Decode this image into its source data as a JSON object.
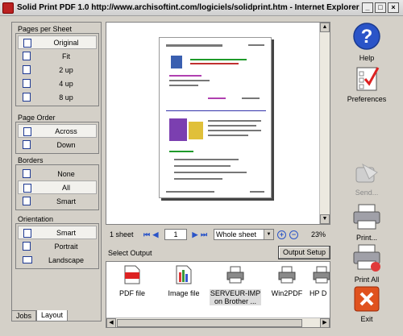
{
  "window": {
    "title": "Solid Print PDF 1.0 http://www.archisoftint.com/logiciels/solidprint.htm - Internet Explorer"
  },
  "left": {
    "pages_per_sheet": {
      "title": "Pages per Sheet",
      "items": [
        "Original",
        "Fit",
        "2 up",
        "4 up",
        "8 up"
      ],
      "selected": "Original"
    },
    "page_order": {
      "title": "Page Order",
      "items": [
        "Across",
        "Down"
      ],
      "selected": "Across"
    },
    "borders": {
      "title": "Borders",
      "items": [
        "None",
        "All",
        "Smart"
      ],
      "selected": "All"
    },
    "orientation": {
      "title": "Orientation",
      "items": [
        "Smart",
        "Portrait",
        "Landscape"
      ],
      "selected": "Smart"
    },
    "tabs": [
      "Jobs",
      "Layout"
    ],
    "active_tab": "Layout"
  },
  "navbar": {
    "sheets": "1 sheet",
    "page": "1",
    "range": "Whole sheet",
    "zoom": "23%"
  },
  "output": {
    "label": "Select Output",
    "setup_button": "Output Setup",
    "items": [
      {
        "label": "PDF file",
        "icon": "pdf-file-icon"
      },
      {
        "label": "Image file",
        "icon": "image-file-icon"
      },
      {
        "label": "SERVEUR-IMP on Brother ...",
        "icon": "printer-icon"
      },
      {
        "label": "Win2PDF",
        "icon": "printer-icon"
      },
      {
        "label": "HP D",
        "icon": "printer-icon"
      }
    ],
    "selected": "SERVEUR-IMP on Brother ..."
  },
  "right": {
    "help": "Help",
    "preferences": "Preferences",
    "send": "Send...",
    "print": "Print...",
    "print_all": "Print All",
    "exit": "Exit"
  },
  "colors": {
    "accent_blue": "#2a54c8",
    "exit_red": "#e0521e",
    "panel": "#d4d0c8"
  }
}
